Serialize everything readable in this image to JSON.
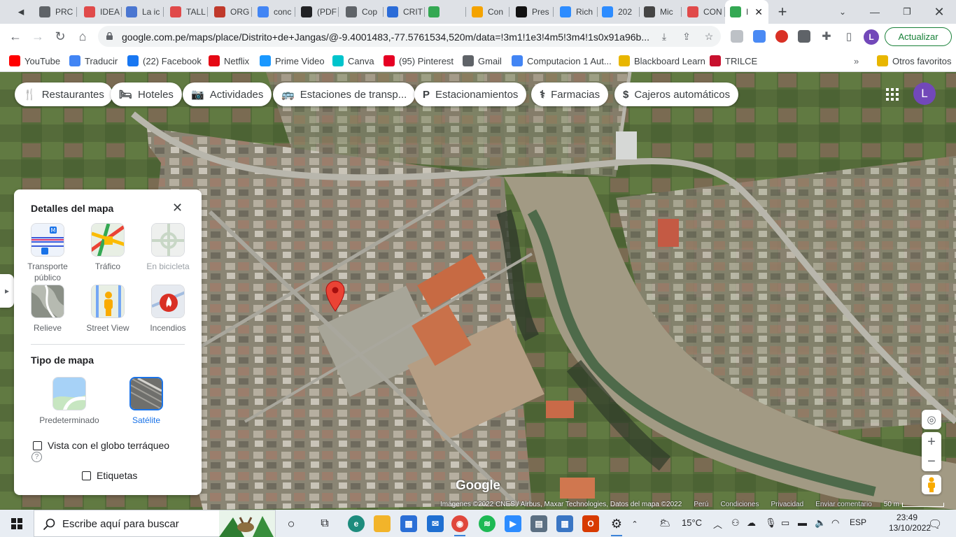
{
  "browser": {
    "tabs": [
      {
        "title": "PRC",
        "icon": "globe-icon",
        "color": "#5f6368"
      },
      {
        "title": "IDEA",
        "icon": "target-icon",
        "color": "#e04a4a"
      },
      {
        "title": "La ic",
        "icon": "idea-icon",
        "color": "#4a76d1"
      },
      {
        "title": "TALL",
        "icon": "target-icon",
        "color": "#e04a4a"
      },
      {
        "title": "ORG",
        "icon": "slides-icon",
        "color": "#c0392b"
      },
      {
        "title": "conc",
        "icon": "google-icon",
        "color": "#4285f4"
      },
      {
        "title": "(PDF",
        "icon": "pdf-icon",
        "color": "#202124"
      },
      {
        "title": "Cop",
        "icon": "globe-icon",
        "color": "#5f6368"
      },
      {
        "title": "CRIT",
        "icon": "canva-icon",
        "color": "#2b6cd8"
      },
      {
        "title": "",
        "icon": "maps-icon",
        "color": "#34a853"
      },
      {
        "title": "Con",
        "icon": "pencil-icon",
        "color": "#f4a300"
      },
      {
        "title": "Pres",
        "icon": "blackboard-icon",
        "color": "#111111"
      },
      {
        "title": "Rich",
        "icon": "zoom-icon",
        "color": "#2d8cff"
      },
      {
        "title": "202",
        "icon": "zoom-icon",
        "color": "#2d8cff"
      },
      {
        "title": "Mic",
        "icon": "pen-icon",
        "color": "#444444"
      },
      {
        "title": "CON",
        "icon": "target-icon",
        "color": "#e04a4a"
      },
      {
        "title": "I",
        "icon": "maps-pin-icon",
        "color": "#34a853"
      }
    ],
    "url": "google.com.pe/maps/place/Distrito+de+Jangas/@-9.4001483,-77.5761534,520m/data=!3m1!1e3!4m5!3m4!1s0x91a96b...",
    "update_label": "Actualizar",
    "profile_letter": "L"
  },
  "bookmarks": [
    {
      "label": "YouTube",
      "icon": "youtube-icon",
      "color": "#ff0000"
    },
    {
      "label": "Traducir",
      "icon": "translate-icon",
      "color": "#4285f4"
    },
    {
      "label": "(22) Facebook",
      "icon": "facebook-icon",
      "color": "#1877f2"
    },
    {
      "label": "Netflix",
      "icon": "netflix-icon",
      "color": "#e50914"
    },
    {
      "label": "Prime Video",
      "icon": "prime-video-icon",
      "color": "#1a98ff"
    },
    {
      "label": "Canva",
      "icon": "canva-icon",
      "color": "#00c4cc"
    },
    {
      "label": "(95) Pinterest",
      "icon": "pinterest-icon",
      "color": "#e60023"
    },
    {
      "label": "Gmail",
      "icon": "globe-icon",
      "color": "#5f6368"
    },
    {
      "label": "Computacion 1 Aut...",
      "icon": "google-icon",
      "color": "#4285f4"
    },
    {
      "label": "Blackboard Learn",
      "icon": "folder-icon",
      "color": "#e8b600"
    },
    {
      "label": "TRILCE",
      "icon": "trilce-icon",
      "color": "#c8102e"
    },
    {
      "label": "Otros favoritos",
      "icon": "folder-icon",
      "color": "#e8b600"
    }
  ],
  "map": {
    "categories": [
      {
        "label": "Restaurantes",
        "icon": "fork-knife-icon",
        "glyph": "🍴"
      },
      {
        "label": "Hoteles",
        "icon": "bed-icon",
        "glyph": "🛏"
      },
      {
        "label": "Actividades",
        "icon": "camera-icon",
        "glyph": "📷"
      },
      {
        "label": "Estaciones de transp...",
        "icon": "bus-icon",
        "glyph": "🚌"
      },
      {
        "label": "Estacionamientos",
        "icon": "parking-icon",
        "glyph": "P"
      },
      {
        "label": "Farmacias",
        "icon": "pharmacy-icon",
        "glyph": "⚕"
      },
      {
        "label": "Cajeros automáticos",
        "icon": "atm-icon",
        "glyph": "$"
      }
    ],
    "account_letter": "L",
    "details_panel": {
      "title": "Detalles del mapa",
      "layers": [
        {
          "label": "Transporte público",
          "state": "normal"
        },
        {
          "label": "Tráfico",
          "state": "normal"
        },
        {
          "label": "En bicicleta",
          "state": "disabled"
        },
        {
          "label": "Relieve",
          "state": "normal"
        },
        {
          "label": "Street View",
          "state": "normal"
        },
        {
          "label": "Incendios",
          "state": "normal"
        }
      ],
      "map_type_title": "Tipo de mapa",
      "map_types": [
        {
          "label": "Predeterminado",
          "selected": false
        },
        {
          "label": "Satélite",
          "selected": true
        }
      ],
      "globe_label": "Vista con el globo terráqueo",
      "labels_label": "Etiquetas",
      "globe_checked": false,
      "labels_checked": false
    },
    "google_logo": "Google",
    "attribution": {
      "imagery": "Imágenes ©2022 CNES / Airbus, Maxar Technologies, Datos del mapa ©2022",
      "country": "Perú",
      "terms": "Condiciones",
      "privacy": "Privacidad",
      "feedback": "Enviar comentario",
      "scale": "50 m"
    }
  },
  "taskbar": {
    "search_placeholder": "Escribe aquí para buscar",
    "temperature": "15°C",
    "language": "ESP",
    "time": "23:49",
    "date": "13/10/2022"
  }
}
